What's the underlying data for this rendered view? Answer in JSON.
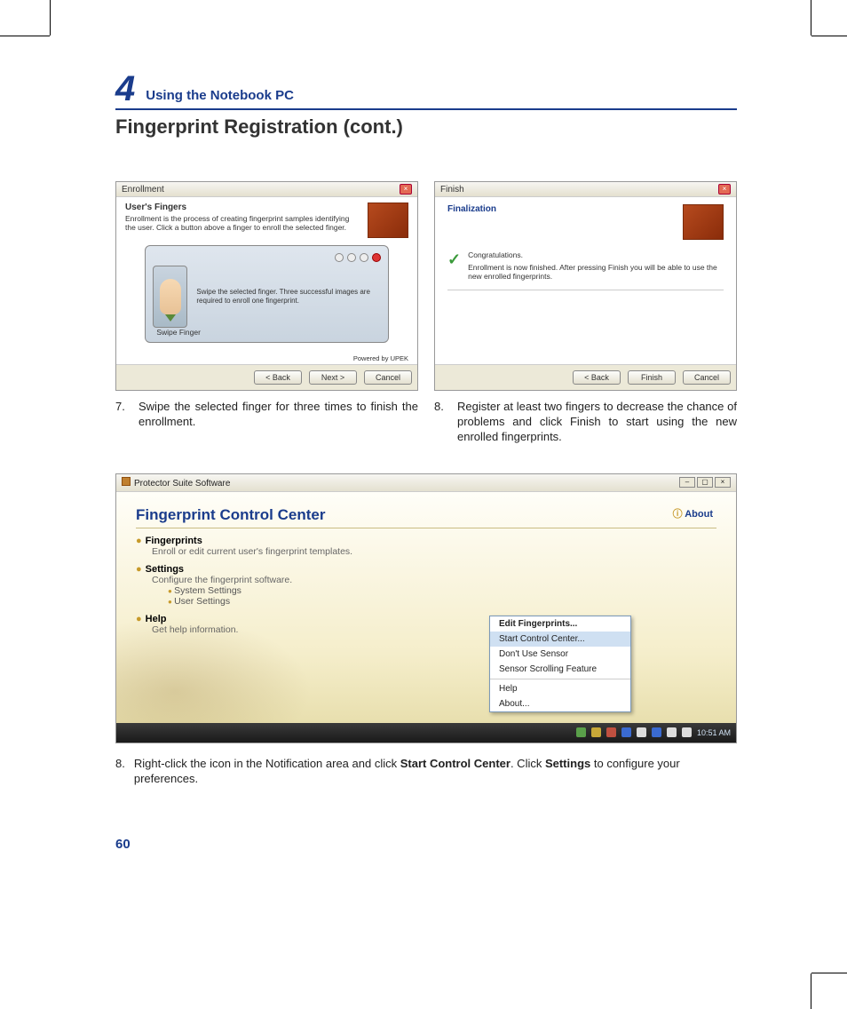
{
  "chapter": {
    "number": "4",
    "title": "Using the Notebook PC"
  },
  "section_title": "Fingerprint Registration (cont.)",
  "enroll_dialog": {
    "titlebar": "Enrollment",
    "heading": "User's Fingers",
    "desc": "Enrollment is the process of creating fingerprint samples identifying the user. Click a button above a finger to enroll the selected finger.",
    "swipe_instr": "Swipe the selected finger. Three successful images are required to enroll one fingerprint.",
    "swipe_label": "Swipe Finger",
    "powered": "Powered by UPEK",
    "back": "< Back",
    "next": "Next >",
    "cancel": "Cancel"
  },
  "finish_dialog": {
    "titlebar": "Finish",
    "heading": "Finalization",
    "congrats": "Congratulations.",
    "msg": "Enrollment is now finished.  After pressing Finish you will be able to use the new enrolled fingerprints.",
    "back": "< Back",
    "finish": "Finish",
    "cancel": "Cancel"
  },
  "caption7": {
    "num": "7.",
    "text": "Swipe the selected finger for three times to finish the enrollment."
  },
  "caption8a": {
    "num": "8.",
    "text": "Register at least two fingers to decrease the chance of problems and click Finish to start using the new enrolled fingerprints."
  },
  "control_center": {
    "window_title": "Protector Suite Software",
    "heading": "Fingerprint Control Center",
    "about": "About",
    "fp_title": "Fingerprints",
    "fp_desc": "Enroll or edit current user's fingerprint templates.",
    "settings_title": "Settings",
    "settings_desc": "Configure the fingerprint software.",
    "settings_sys": "System Settings",
    "settings_user": "User Settings",
    "help_title": "Help",
    "help_desc": "Get help information."
  },
  "context_menu": {
    "edit": "Edit Fingerprints...",
    "start": "Start Control Center...",
    "dont": "Don't Use Sensor",
    "scroll": "Sensor Scrolling Feature",
    "help": "Help",
    "about": "About..."
  },
  "taskbar_time": "10:51 AM",
  "caption8b": {
    "num": "8.",
    "pre": "Right-click the icon in the Notification area and click ",
    "bold1": "Start Control Center",
    "mid": ". Click ",
    "bold2": "Settings",
    "post": " to configure your preferences."
  },
  "page_number": "60"
}
